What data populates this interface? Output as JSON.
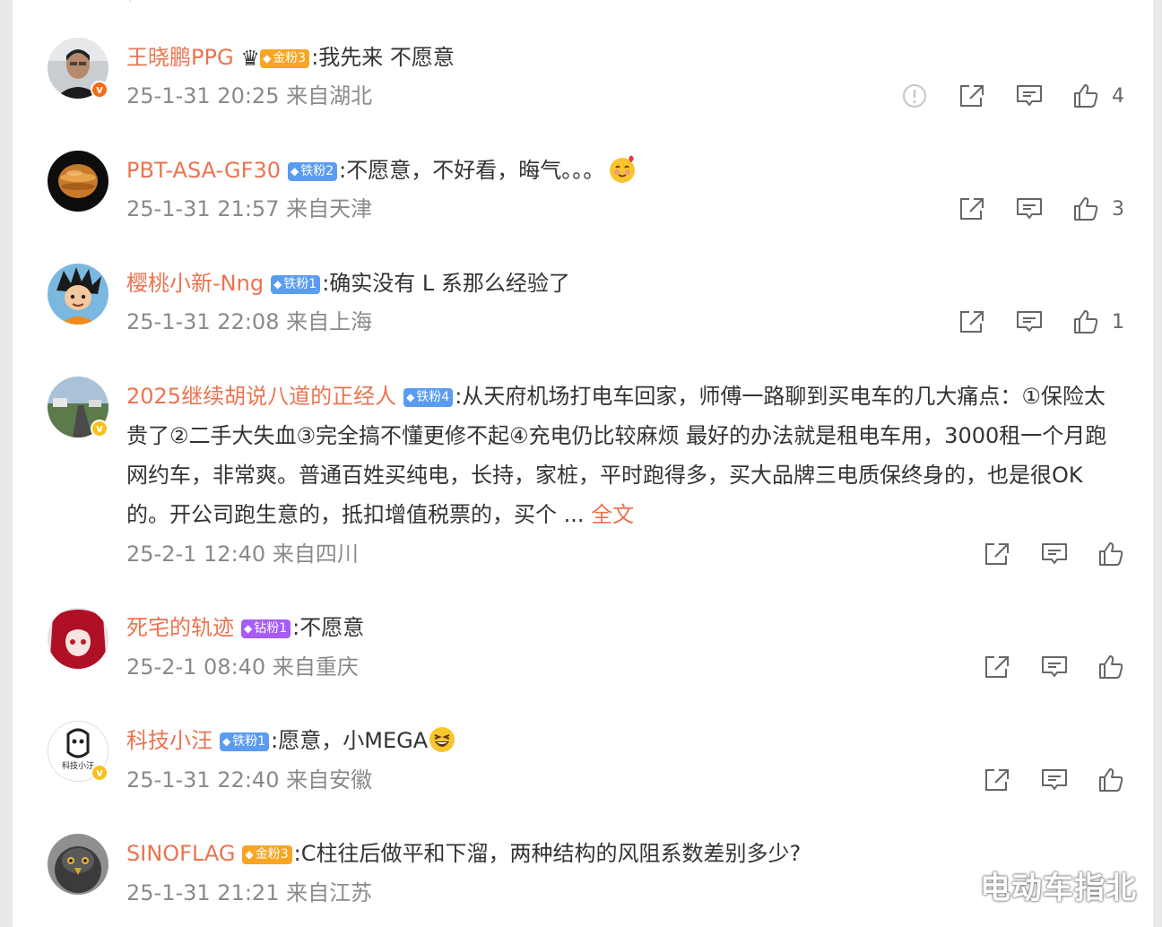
{
  "comments": [
    {
      "username": "王晓鹏PPG",
      "badge": "金粉3",
      "badge_type": "gold",
      "has_crown": true,
      "text": ":我先来 不愿意",
      "meta": "25-1-31 20:25 来自湖北",
      "likes": "4",
      "verified": "orange"
    },
    {
      "username": "PBT-ASA-GF30",
      "badge": "铁粉2",
      "badge_type": "iron",
      "text": ":不愿意，不好看，晦气。。。",
      "emoji": "smiling-face-with-hearts",
      "meta": "25-1-31 21:57 来自天津",
      "likes": "3"
    },
    {
      "username": "樱桃小新-Nng",
      "badge": "铁粉1",
      "badge_type": "iron",
      "text": ":确实没有 L 系那么经验了",
      "meta": "25-1-31 22:08 来自上海",
      "likes": "1"
    },
    {
      "username": "2025继续胡说八道的正经人",
      "badge": "铁粉4",
      "badge_type": "iron",
      "text": ":从天府机场打电车回家，师傅一路聊到买电车的几大痛点：①保险太贵了②二手大失血③完全搞不懂更修不起④充电仍比较麻烦  最好的办法就是租电车用，3000租一个月跑网约车，非常爽。普通百姓买纯电，长持，家桩，平时跑得多，买大品牌三电质保终身的，也是很OK的。开公司跑生意的，抵扣增值税票的，买个 ...",
      "more": "全文",
      "meta": "25-2-1 12:40 来自四川",
      "likes": "",
      "verified": "gold"
    },
    {
      "username": "死宅的轨迹",
      "badge": "钻粉1",
      "badge_type": "diamond",
      "text": ":不愿意",
      "meta": "25-2-1 08:40 来自重庆",
      "likes": ""
    },
    {
      "username": "科技小汪",
      "badge": "铁粉1",
      "badge_type": "iron",
      "text": ":愿意，小MEGA",
      "emoji": "grinning-squinting-face",
      "meta": "25-1-31 22:40 来自安徽",
      "likes": "",
      "verified": "gold"
    },
    {
      "username": "SINOFLAG",
      "badge": "金粉3",
      "badge_type": "gold",
      "text": ":C柱往后做平和下溜，两种结构的风阻系数差别多少?",
      "meta": "25-1-31 21:21 来自江苏",
      "likes": ""
    }
  ],
  "watermark": "电动车指北",
  "avatar_logo_text": "科技小汪",
  "icons": {
    "report": "report-icon",
    "share": "share-icon",
    "comment": "comment-icon",
    "like": "thumbs-up-icon"
  },
  "colors": {
    "username": "#eb7350",
    "meta": "#8a8a8a",
    "gold_badge": "#f8a524",
    "iron_badge": "#5b9cf0",
    "diamond_badge": "#a65cf5"
  }
}
